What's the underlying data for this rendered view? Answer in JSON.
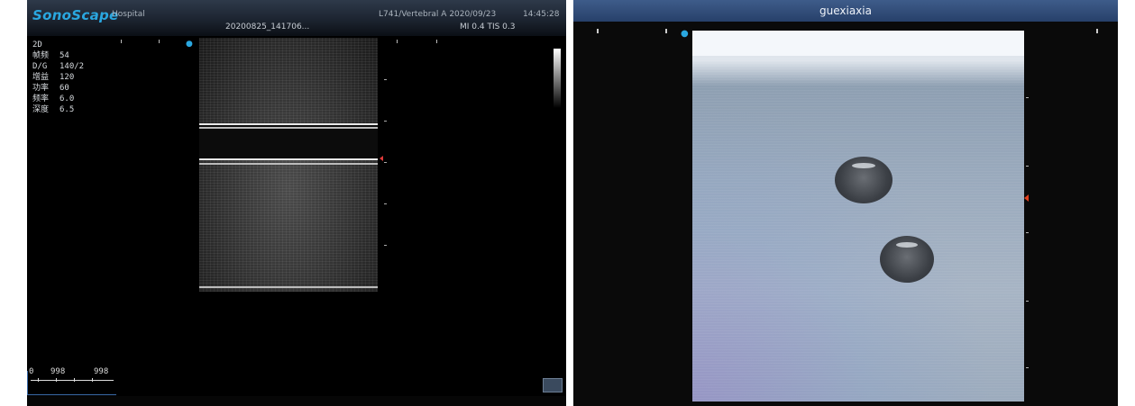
{
  "left_panel": {
    "brand": "SonoScape",
    "hospital": "Hospital",
    "file_name": "20200825_141706...",
    "probe_preset": "L741/Vertebral A",
    "date": "2020/09/23",
    "time": "14:45:28",
    "indices": "MI 0.4 TIS 0.3",
    "mode": "2D",
    "params": [
      {
        "key": "帧频",
        "value": "54"
      },
      {
        "key": "D/G",
        "value": "140/2"
      },
      {
        "key": "增益",
        "value": "120"
      },
      {
        "key": "功率",
        "value": "60"
      },
      {
        "key": "频率",
        "value": "6.0"
      },
      {
        "key": "深度",
        "value": "6.5"
      }
    ],
    "scale_labels": [
      "0",
      "998",
      "998"
    ]
  },
  "right_panel": {
    "title": "guexiaxia"
  },
  "colors": {
    "brand_blue": "#2aa7e0",
    "focus_marker": "#e03a3a",
    "header_right": "#3e5c8a"
  }
}
